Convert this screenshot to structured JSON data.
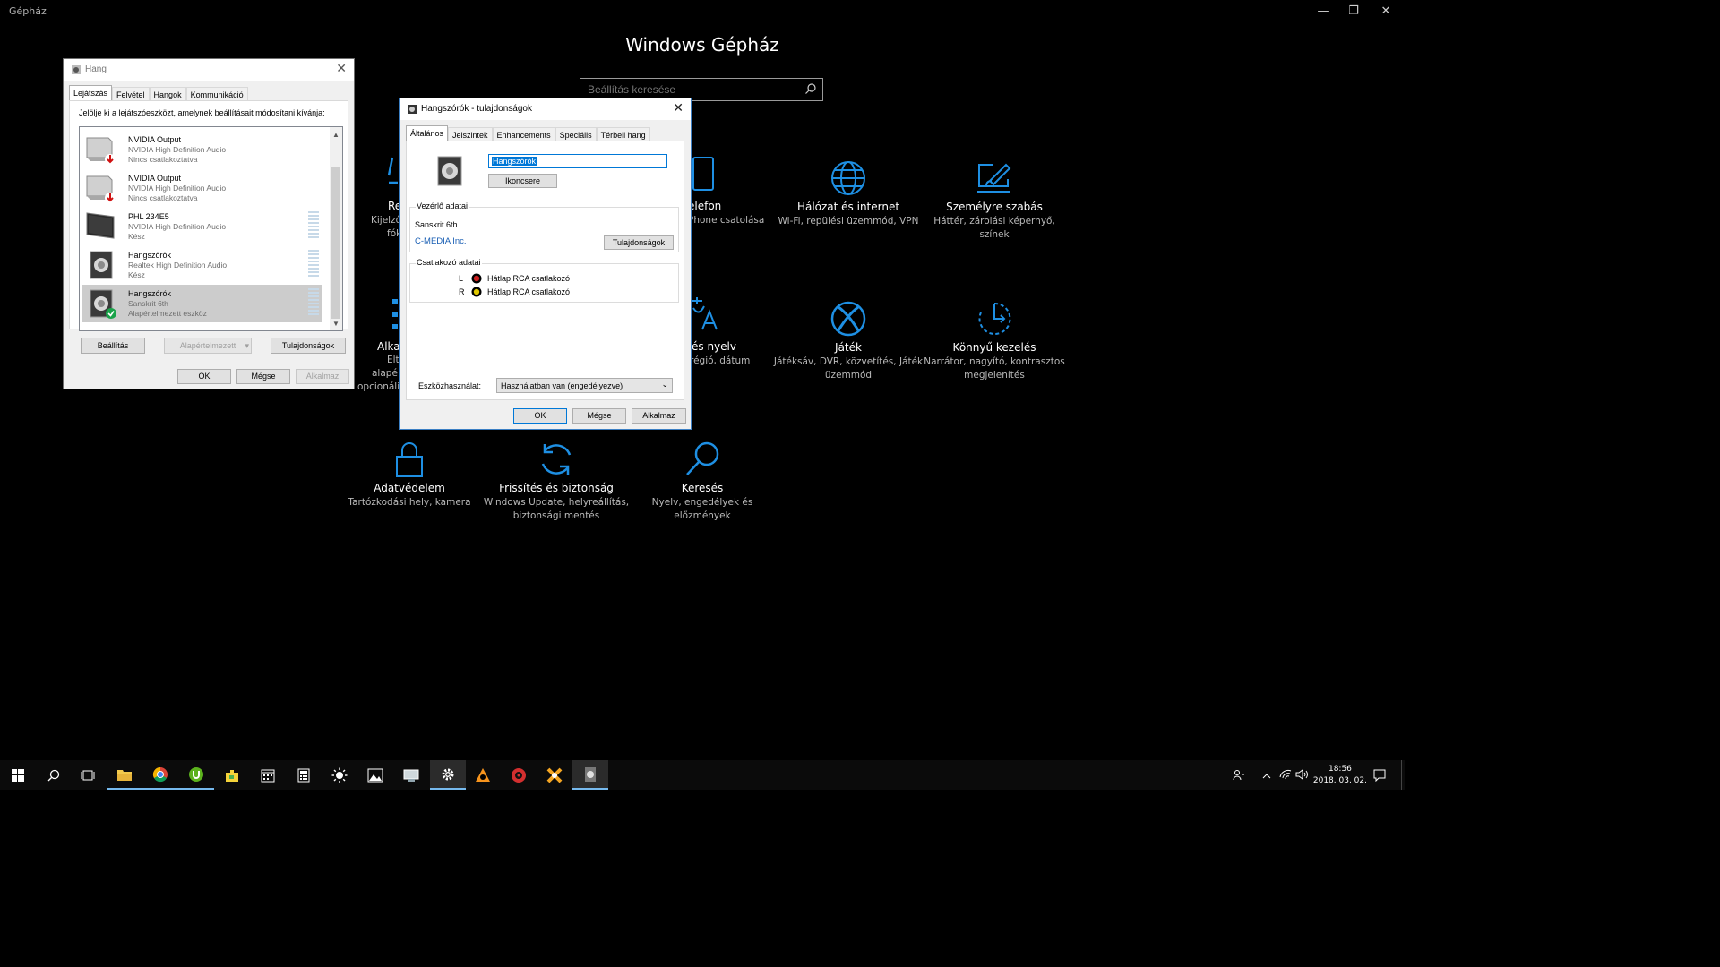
{
  "settings": {
    "window_title": "Gépház",
    "heading": "Windows Gépház",
    "search_placeholder": "Beállítás keresése",
    "partial_left": {
      "row1_title": "Re",
      "row1_sub1": "Kijelző",
      "row1_sub2": "fók",
      "row2_title": "Alka",
      "row2_sub1": "Elt",
      "row2_sub2": "alapé",
      "row2_sub3": "opcionális"
    },
    "phone": {
      "title": "elefon",
      "sub": "Phone csatolása"
    },
    "language": {
      "title": "és nyelv",
      "sub": "régió, dátum"
    },
    "network": {
      "title": "Hálózat és internet",
      "sub": "Wi-Fi, repülési üzemmód, VPN"
    },
    "personalize": {
      "title": "Személyre szabás",
      "sub": "Háttér, zárolási képernyő, színek"
    },
    "gaming": {
      "title": "Játék",
      "sub": "Játéksáv, DVR, közvetítés, Játék üzemmód"
    },
    "ease": {
      "title": "Könnyű kezelés",
      "sub": "Narrátor, nagyító, kontrasztos megjelenítés"
    },
    "privacy": {
      "title": "Adatvédelem",
      "sub": "Tartózkodási hely, kamera"
    },
    "update": {
      "title": "Frissítés és biztonság",
      "sub": "Windows Update, helyreállítás, biztonsági mentés"
    },
    "search": {
      "title": "Keresés",
      "sub": "Nyelv, engedélyek és előzmények"
    },
    "accent": "#1e8fe3"
  },
  "sound_dialog": {
    "title": "Hang",
    "tabs": [
      "Lejátszás",
      "Felvétel",
      "Hangok",
      "Kommunikáció"
    ],
    "instruction": "Jelölje ki a lejátszóeszközt, amelynek beállításait módosítani kívánja:",
    "devices": [
      {
        "name": "NVIDIA Output",
        "driver": "NVIDIA High Definition Audio",
        "status": "Nincs csatlakoztatva"
      },
      {
        "name": "NVIDIA Output",
        "driver": "NVIDIA High Definition Audio",
        "status": "Nincs csatlakoztatva"
      },
      {
        "name": "PHL 234E5",
        "driver": "NVIDIA High Definition Audio",
        "status": "Kész"
      },
      {
        "name": "Hangszórók",
        "driver": "Realtek High Definition Audio",
        "status": "Kész"
      },
      {
        "name": "Hangszórók",
        "driver": "Sanskrit 6th",
        "status": "Alapértelmezett eszköz"
      }
    ],
    "buttons": {
      "configure": "Beállítás",
      "set_default": "Alapértelmezett",
      "properties": "Tulajdonságok",
      "ok": "OK",
      "cancel": "Mégse",
      "apply": "Alkalmaz"
    }
  },
  "props_dialog": {
    "title": "Hangszórók - tulajdonságok",
    "tabs": [
      "Általános",
      "Jelszintek",
      "Enhancements",
      "Speciális",
      "Térbeli hang"
    ],
    "name_value": "Hangszórók",
    "change_icon": "Ikoncsere",
    "controller_group": "Vezérlő adatai",
    "controller_name": "Sanskrit 6th",
    "vendor": "C-MEDIA Inc.",
    "controller_props": "Tulajdonságok",
    "jack_group": "Csatlakozó adatai",
    "jacks": [
      {
        "ch": "L",
        "label": "Hátlap RCA csatlakozó",
        "color": "#cc1f1f"
      },
      {
        "ch": "R",
        "label": "Hátlap RCA csatlakozó",
        "color": "#e0c800"
      }
    ],
    "usage_label": "Eszközhasználat:",
    "usage_value": "Használatban van (engedélyezve)",
    "ok": "OK",
    "cancel": "Mégse",
    "apply": "Alkalmaz"
  },
  "taskbar": {
    "time": "18:56",
    "date": "2018. 03. 02."
  }
}
